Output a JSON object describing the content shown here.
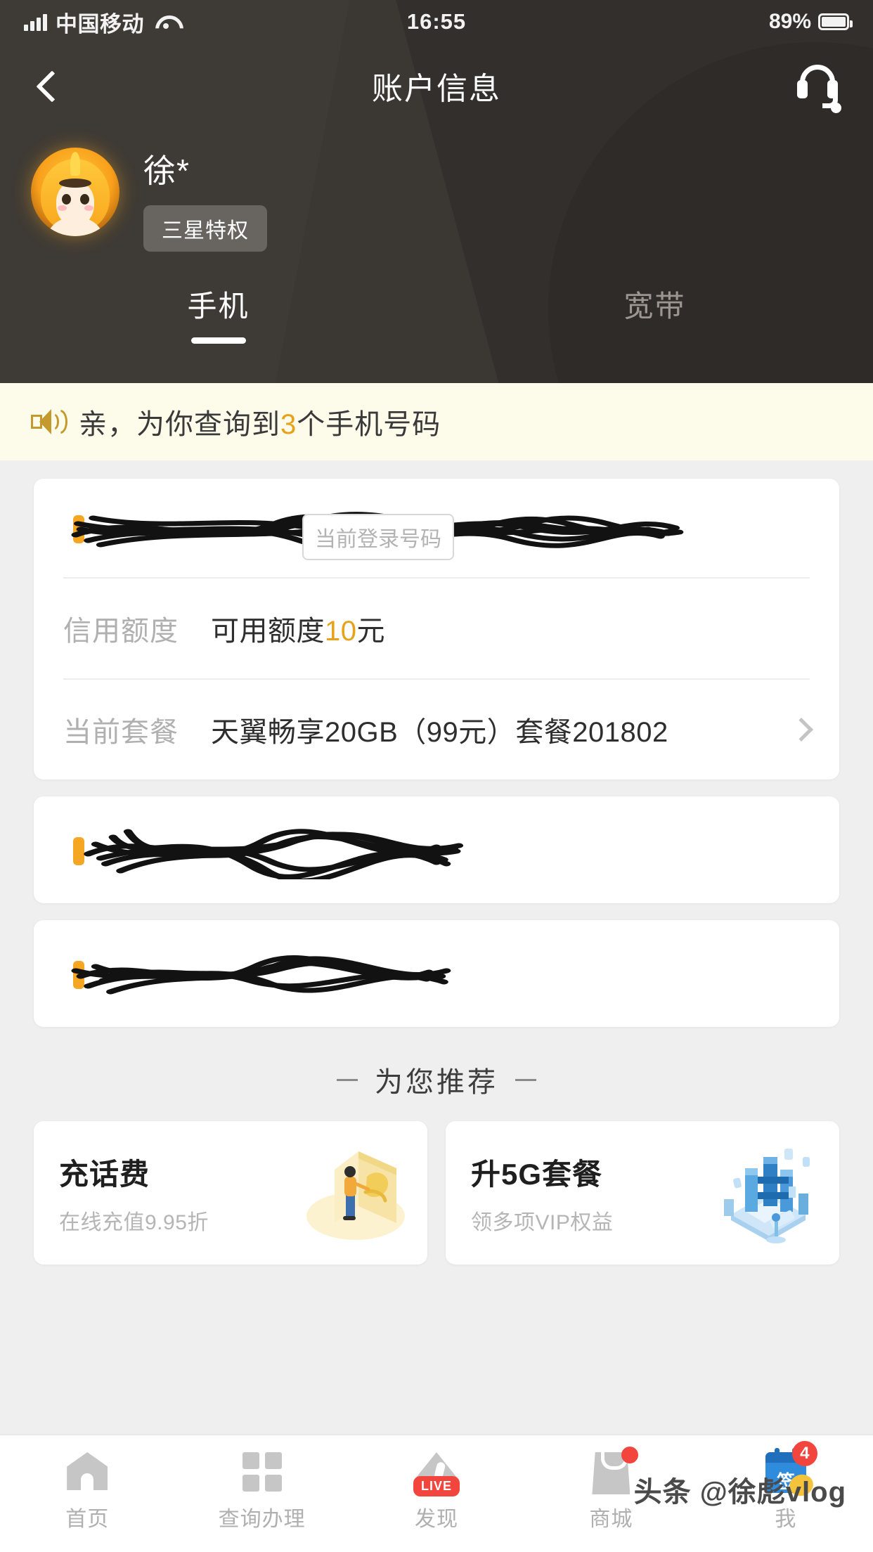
{
  "status_bar": {
    "carrier": "中国移动",
    "time": "16:55",
    "battery": "89%",
    "signal_icon": "signal-bars-icon",
    "wifi_icon": "wifi-icon",
    "battery_icon": "battery-icon"
  },
  "nav": {
    "title": "账户信息",
    "back_icon": "back-chevron-icon",
    "support_icon": "headset-icon"
  },
  "profile": {
    "name": "徐*",
    "badge": "三星特权",
    "avatar_icon": "avatar-cartoon-icon"
  },
  "tabs": [
    {
      "label": "手机",
      "active": true
    },
    {
      "label": "宽带",
      "active": false
    }
  ],
  "banner": {
    "icon": "speaker-announce-icon",
    "prefix": "亲，为你查询到",
    "count": "3",
    "suffix": "个手机号码"
  },
  "accounts": [
    {
      "number_masked": "",
      "number_redacted": true,
      "tag": "当前登录号码",
      "rows": [
        {
          "label": "信用额度",
          "value_prefix": "可用额度",
          "value_highlight": "10",
          "value_suffix": "元",
          "has_chevron": false
        },
        {
          "label": "当前套餐",
          "value_prefix": "天翼畅享20GB（99元）套餐201802",
          "value_highlight": "",
          "value_suffix": "",
          "has_chevron": true
        }
      ]
    },
    {
      "number_masked": "",
      "number_redacted": true,
      "tag": "",
      "rows": []
    },
    {
      "number_masked": "",
      "number_redacted": true,
      "tag": "",
      "rows": []
    }
  ],
  "recommend": {
    "heading": "为您推荐",
    "cards": [
      {
        "title": "充话费",
        "subtitle": "在线充值9.95折",
        "illustration": "wallet-coin-illustration",
        "accent": "#f3c969"
      },
      {
        "title": "升5G套餐",
        "subtitle": "领多项VIP权益",
        "illustration": "5g-network-illustration",
        "accent": "#4a9fe0"
      }
    ]
  },
  "tabbar": [
    {
      "label": "首页",
      "icon": "home-icon",
      "badge": "",
      "dot": false
    },
    {
      "label": "查询办理",
      "icon": "grid-icon",
      "badge": "",
      "dot": false
    },
    {
      "label": "发现",
      "icon": "compass-icon",
      "badge": "LIVE",
      "dot": false
    },
    {
      "label": "商城",
      "icon": "shop-bag-icon",
      "badge": "",
      "dot": true
    },
    {
      "label": "我",
      "icon": "calendar-signin-icon",
      "badge": "4",
      "dot": false
    }
  ],
  "watermark": "头条 @徐彪vlog",
  "colors": {
    "header_bg": "#3b3733",
    "accent_gold": "#e8a21a",
    "banner_bg": "#fdfbe9",
    "page_bg": "#efefef",
    "badge_red": "#f2453d"
  }
}
